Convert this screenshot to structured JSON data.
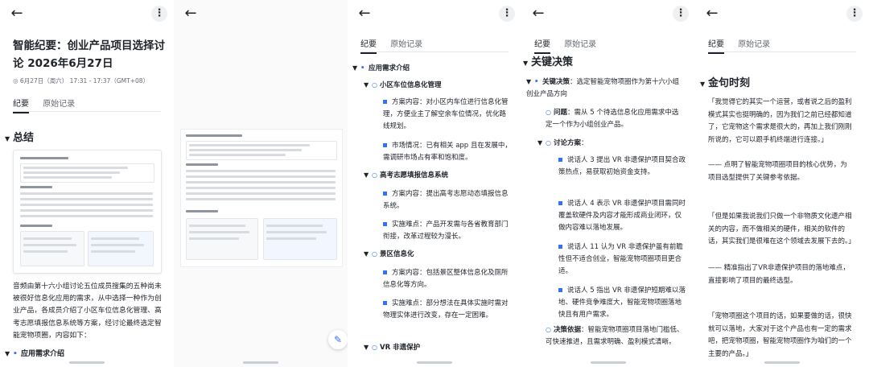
{
  "panel1": {
    "title": "智能纪要：创业产品项目选择讨论 2026年6月27日",
    "meta": "◎ 6月27日（周六） 17:31 - 17:37（GMT+08）",
    "tabs": [
      "纪要",
      "原始记录"
    ],
    "section_summary": "总结",
    "summary_text": "音频由第十六小组讨论五位成员搜集的五种尚未被很好信息化应用的需求，从中选择一种作为创业产品，各成员介绍了小区车位信息化管理、高考志愿填报信息系统等方案，经讨论最终选定智能宠物项圈，内容如下：",
    "last_item": "应用需求介绍"
  },
  "panel3": {
    "tabs": [
      "纪要",
      "原始记录"
    ],
    "root": "应用需求介绍",
    "sub1": "小区车位信息化管理",
    "sub1_items": [
      "方案内容：对小区内车位进行信息化管理，方便业主了解空余车位情况，优化路线规划。",
      "市场情况：已有相关 app 且在发展中，需调研市场占有率和饱和度。"
    ],
    "sub2": "高考志愿填报信息系统",
    "sub2_items": [
      "方案内容：提出高考志愿动态填报信息系统。",
      "实施难点：产品开发需与各省教育部门衔接，改革过程较为漫长。"
    ],
    "sub3": "景区信息化",
    "sub3_items": [
      "方案内容：包括景区整体信息化及厕所信息化等方向。",
      "实施难点：部分想法在具体实施时需对物理实体进行改变，存在一定困难。"
    ],
    "sub4": "VR 非遗保护"
  },
  "panel4": {
    "tabs": [
      "纪要",
      "原始记录"
    ],
    "section": "关键决策",
    "decision_label": "关键决策",
    "decision_text": "：选定智能宠物项圈作为第十六小组创业产品方向",
    "problem_label": "问题",
    "problem_text": "：需从 5 个待选信息化应用需求中选定一个作为小组创业产品。",
    "discussion_label": "讨论方案",
    "discussion_items": [
      "说话人 3 提出 VR 非遗保护项目契合政策热点，易获取初始资金支持。",
      "说话人 4 表示 VR 非遗保护项目需同时覆盖软硬件及内容才能形成商业闭环，仅做内容难以落地发展。",
      "说话人 11 认为 VR 非遗保护虽有前瞻性但不适合创业，智能宠物项圈项目更合适。",
      "说话人 5 指出 VR 非遗保护短期难以落地、硬件竞争难度大，智能宠物项圈落地快且有用户需求。"
    ],
    "basis_label": "决策依据",
    "basis_text": "：智能宠物项圈项目落地门槛低、可快速推进，且需求明确、盈利模式清晰。"
  },
  "panel5": {
    "tabs": [
      "纪要",
      "原始记录"
    ],
    "section": "金句时刻",
    "quotes": [
      {
        "text": "「我觉得它的其实一个运营，或者说之后的盈利模式其实也挺明确的，因为我们之前已经都知道了，它宠物这个需求是很大的，再加上我们刚刚所说的，它可以跟手机终端进行连接。」",
        "note": "—— 点明了智能宠物项圈项目的核心优势，为项目选型提供了关键参考依据。"
      },
      {
        "text": "「但是如果我说我们只做一个非物质文化遗产相关的内容，而不做相关的硬件，相关的软件的话，其实我们是很难在这个领域去发展下去的。」",
        "note": "—— 精准指出了VR非遗保护项目的落地难点，直接影响了项目的最终选型。"
      },
      {
        "text": "「宠物项圈这个项目的话，如果要做的话，很快就可以落地，大家对于这个产品也有一定的需求吧，把宠物项圈，智能宠物项圈作为咱们的一个主要的产品。」",
        "note": ""
      }
    ]
  }
}
